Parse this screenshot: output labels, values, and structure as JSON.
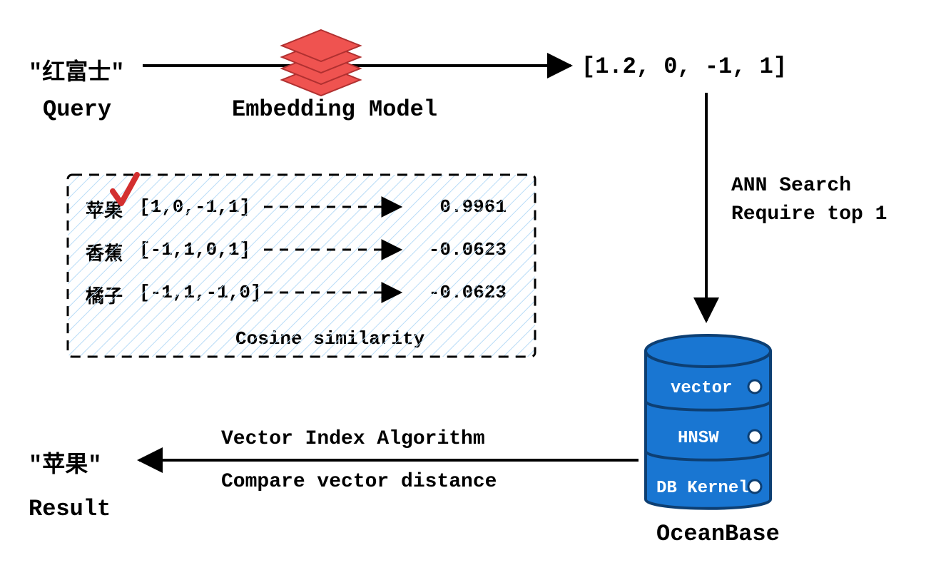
{
  "query": {
    "text": "\"红富士\"",
    "label": "Query"
  },
  "embedding": {
    "label": "Embedding Model"
  },
  "vector": {
    "text": "[1.2, 0, -1, 1]"
  },
  "ann": {
    "line1": "ANN Search",
    "line2": "Require top 1"
  },
  "db": {
    "layer1": "vector",
    "layer2": "HNSW",
    "layer3": "DB Kernel",
    "name": "OceanBase"
  },
  "algo": {
    "line1": "Vector Index Algorithm",
    "line2": "Compare vector distance"
  },
  "result": {
    "text": "\"苹果\"",
    "label": "Result"
  },
  "box": {
    "caption": "Cosine similarity",
    "rows": [
      {
        "name": "苹果",
        "vec": "[1,0,-1,1]",
        "score": "0.9961",
        "selected": true
      },
      {
        "name": "香蕉",
        "vec": "[-1,1,0,1]",
        "score": "-0.0623",
        "selected": false
      },
      {
        "name": "橘子",
        "vec": "[-1,1,-1,0]",
        "score": "-0.0623",
        "selected": false
      }
    ]
  }
}
